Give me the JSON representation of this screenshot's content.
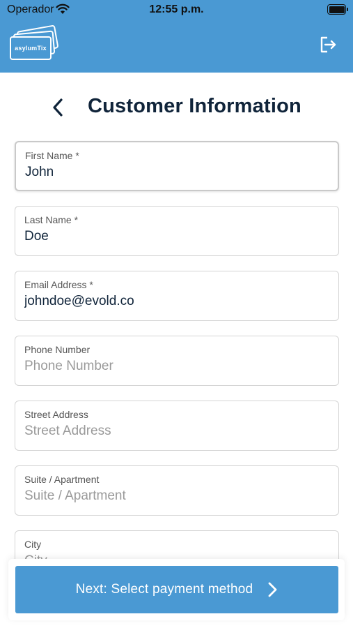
{
  "status_bar": {
    "carrier": "Operador",
    "time": "12:55 p.m."
  },
  "header": {
    "logo_text": "asylumTix",
    "logout_icon": "logout-icon"
  },
  "page": {
    "title": "Customer Information",
    "back_icon": "chevron-left-icon"
  },
  "form": {
    "first_name": {
      "label": "First Name *",
      "value": "John",
      "placeholder": "First Name"
    },
    "last_name": {
      "label": "Last Name *",
      "value": "Doe",
      "placeholder": "Last Name"
    },
    "email": {
      "label": "Email Address *",
      "value": "johndoe@evold.co",
      "placeholder": "Email Address"
    },
    "phone": {
      "label": "Phone Number",
      "value": "",
      "placeholder": "Phone Number"
    },
    "street": {
      "label": "Street Address",
      "value": "",
      "placeholder": "Street Address"
    },
    "suite": {
      "label": "Suite / Apartment",
      "value": "",
      "placeholder": "Suite / Apartment"
    },
    "city": {
      "label": "City",
      "value": "",
      "placeholder": "City"
    }
  },
  "footer": {
    "next_label": "Next: Select payment method",
    "next_icon": "chevron-right-icon"
  },
  "colors": {
    "brand_blue": "#4a99d3",
    "title_text": "#10243a"
  }
}
